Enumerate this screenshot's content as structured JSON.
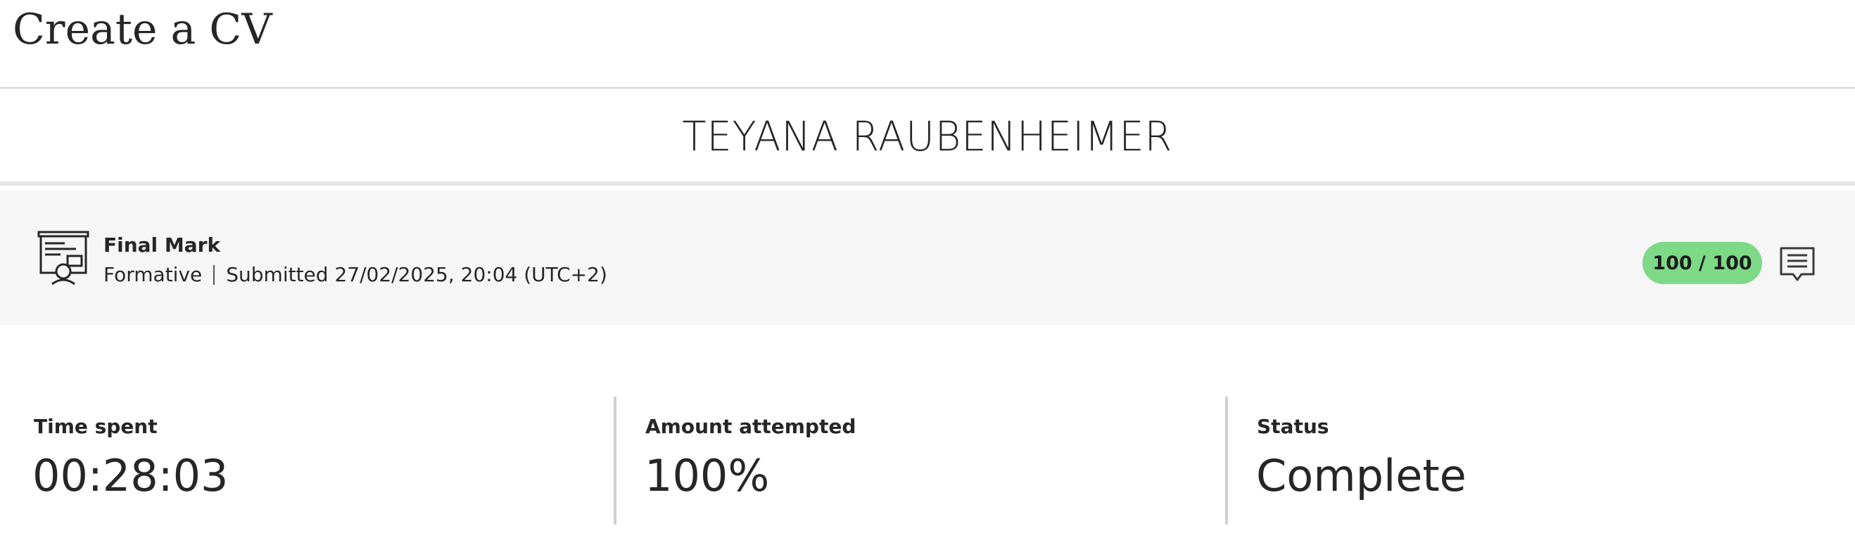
{
  "page": {
    "title": "Create a CV"
  },
  "student": {
    "name": "TEYANA RAUBENHEIMER"
  },
  "final_mark": {
    "icon": "certificate-presentation-icon",
    "title": "Final Mark",
    "type": "Formative",
    "submitted": "Submitted 27/02/2025, 20:04 (UTC+2)",
    "score": "100 / 100",
    "score_color": "#7ed987",
    "feedback_icon": "comment-icon"
  },
  "stats": [
    {
      "label": "Time spent",
      "value": "00:28:03"
    },
    {
      "label": "Amount attempted",
      "value": "100%"
    },
    {
      "label": "Status",
      "value": "Complete"
    }
  ]
}
